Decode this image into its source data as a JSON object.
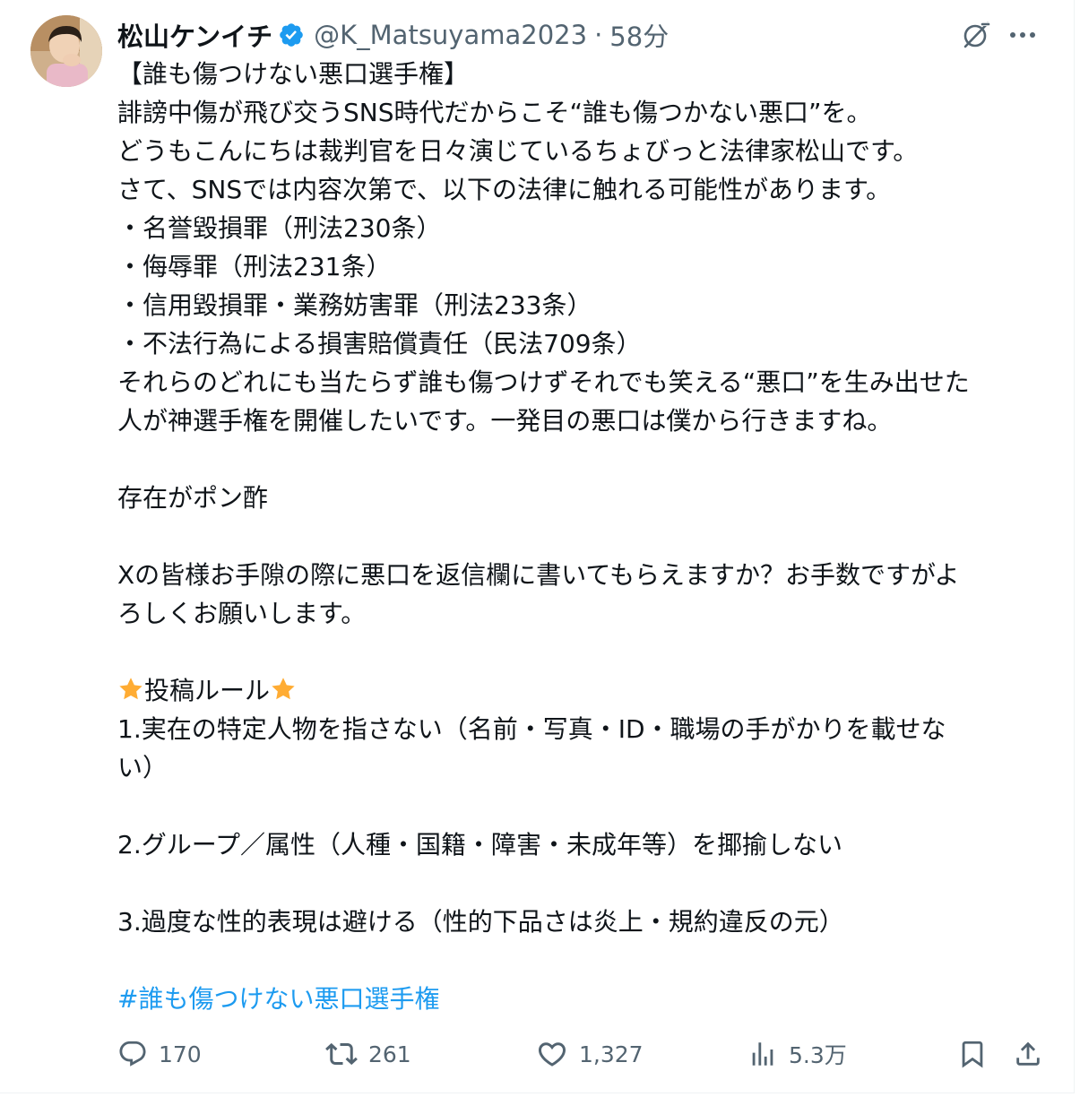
{
  "tweet": {
    "display_name": "松山ケンイチ",
    "handle": "@K_Matsuyama2023",
    "separator": "·",
    "time": "58分",
    "lines": [
      "【誰も傷つけない悪口選手権】",
      "誹謗中傷が飛び交うSNS時代だからこそ“誰も傷つかない悪口”を。",
      "どうもこんにちは裁判官を日々演じているちょびっと法律家松山です。",
      "さて、SNSでは内容次第で、以下の法律に触れる可能性があります。",
      "・名誉毀損罪（刑法230条）",
      "・侮辱罪（刑法231条）",
      "・信用毀損罪・業務妨害罪（刑法233条）",
      "・不法行為による損害賠償責任（民法709条）",
      "それらのどれにも当たらず誰も傷つけずそれでも笑える“悪口”を生み出せた",
      "人が神選手権を開催したいです。一発目の悪口は僕から行きますね。",
      "存在がポン酢",
      "Xの皆様お手隙の際に悪口を返信欄に書いてもらえますか？お手数ですがよ",
      "ろしくお願いします。",
      "投稿ルール",
      "1.実在の特定人物を指さない（名前・写真・ID・職場の手がかりを載せな",
      "い）",
      "2.グループ／属性（人種・国籍・障害・未成年等）を揶揄しない",
      "3.過度な性的表現は避ける（性的下品さは炎上・規約違反の元）"
    ],
    "hashtag": "#誰も傷つけない悪口選手権"
  },
  "stats": {
    "replies": "170",
    "reposts": "261",
    "likes": "1,327",
    "views": "5.3万"
  },
  "colors": {
    "text": "#0f1419",
    "secondary": "#536471",
    "link": "#1d9bf0",
    "verified": "#1d9bf0",
    "star": "#ffac33"
  },
  "icons": {
    "verified": "verified-badge-icon",
    "grok": "grok-icon",
    "more": "more-icon",
    "reply": "reply-icon",
    "repost": "repost-icon",
    "like": "heart-icon",
    "views": "views-icon",
    "bookmark": "bookmark-icon",
    "share": "share-icon",
    "star": "star-emoji-icon"
  }
}
